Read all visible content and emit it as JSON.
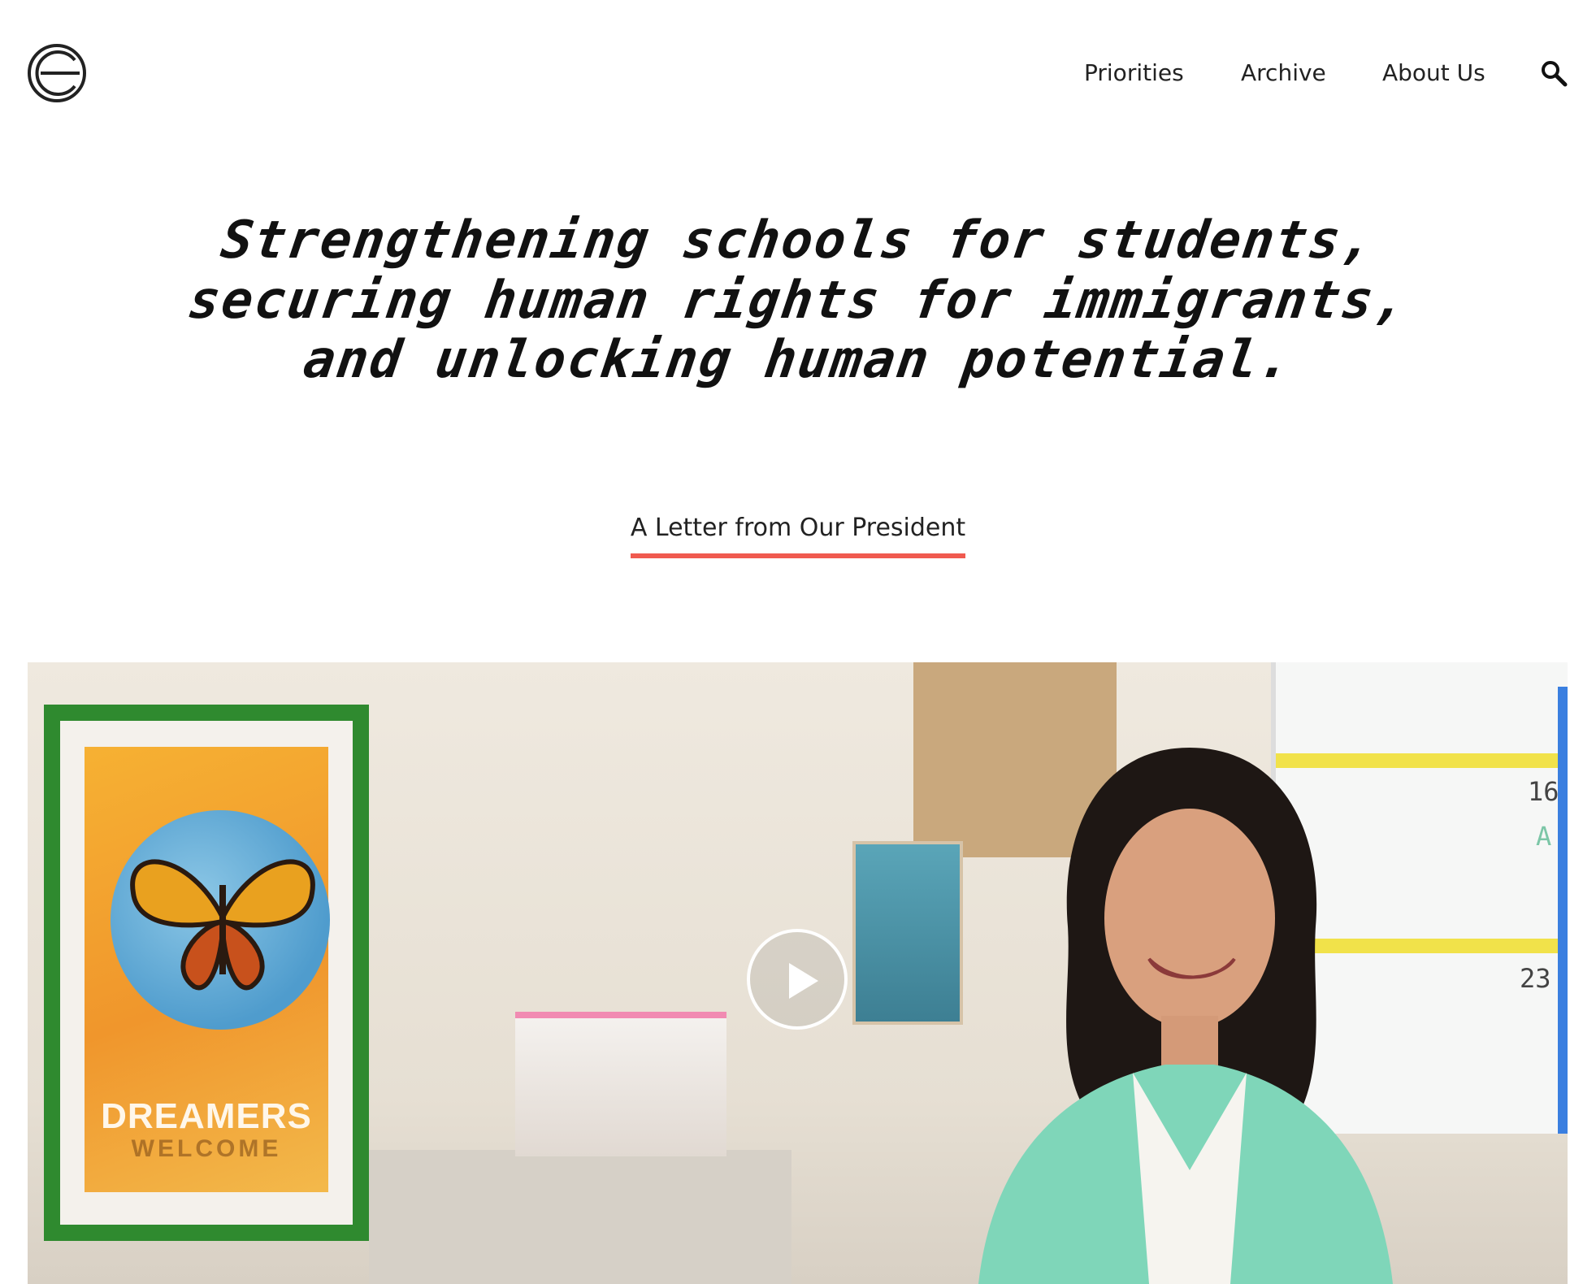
{
  "nav": {
    "items": [
      {
        "label": "Priorities"
      },
      {
        "label": "Archive"
      },
      {
        "label": "About Us"
      }
    ],
    "search_icon": "search-icon"
  },
  "hero": {
    "lines": [
      "Strengthening schools for students,",
      "securing human rights for immigrants,",
      "and unlocking human potential."
    ],
    "link_label": "A Letter from Our President"
  },
  "video": {
    "poster_title": "DREAMERS",
    "poster_subtitle": "WELCOME",
    "whiteboard_numbers": [
      "16",
      "A",
      "23"
    ],
    "play_icon": "play-icon"
  },
  "colors": {
    "accent": "#f05a4f",
    "text": "#222222",
    "background": "#ffffff"
  }
}
